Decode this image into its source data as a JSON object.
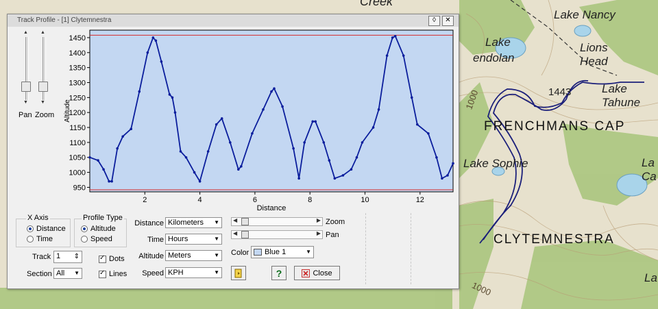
{
  "map": {
    "labels": [
      "Creek",
      "Lake Nancy",
      "Lake",
      "Lake",
      "endolan",
      "Lions",
      "Head",
      "1443",
      "Lake",
      "Tahune",
      "FRENCHMANS CAP",
      "Lake Sophie",
      "La",
      "Ca",
      "CLYTEMNESTRA",
      "1000",
      "1000",
      "La"
    ],
    "colors": {
      "water": "#a9d4ea",
      "forest": "#a7c47a",
      "track": "#1b1f7a"
    }
  },
  "window": {
    "title": "Track Profile - [1] Clytemnestra",
    "buttons": {
      "restore": "◊",
      "close": "✕"
    }
  },
  "sliders": {
    "pan_label": "Pan",
    "zoom_label": "Zoom",
    "pan_level": 0.83,
    "zoom_level": 0.83
  },
  "x_axis_group": {
    "title": "X Axis",
    "options": [
      "Distance",
      "Time"
    ],
    "selected": "Distance"
  },
  "profile_type_group": {
    "title": "Profile Type",
    "options": [
      "Altitude",
      "Speed"
    ],
    "selected": "Altitude"
  },
  "track": {
    "label": "Track",
    "value": "1"
  },
  "section": {
    "label": "Section",
    "value": "All"
  },
  "checks": {
    "dots_label": "Dots",
    "dots": true,
    "lines_label": "Lines",
    "lines": true
  },
  "units": {
    "distance_label": "Distance",
    "distance": "Kilometers",
    "time_label": "Time",
    "time": "Hours",
    "altitude_label": "Altitude",
    "altitude": "Meters",
    "speed_label": "Speed",
    "speed": "KPH"
  },
  "view": {
    "zoom_label": "Zoom",
    "pan_label": "Pan",
    "zoom_position": 0.0,
    "pan_position": 0.0
  },
  "color": {
    "label": "Color",
    "value": "Blue 1",
    "swatch": "#c3d7f2"
  },
  "buttons": {
    "help": "?",
    "close": "Close"
  },
  "chart_data": {
    "type": "line",
    "xlabel": "Distance",
    "ylabel": "Altitude",
    "xlim": [
      0,
      13.2
    ],
    "ylim": [
      935,
      1475
    ],
    "x_ticks": [
      2,
      4,
      6,
      8,
      10,
      12
    ],
    "y_ticks": [
      950,
      1000,
      1050,
      1100,
      1150,
      1200,
      1250,
      1300,
      1350,
      1400,
      1450
    ],
    "max_line": 1458,
    "min_line": 942,
    "plot_bg": "#c3d7f2",
    "line_color": "#0a1d9c",
    "ref_line_color": "#d42b2b",
    "series": [
      {
        "x": [
          0,
          0.3,
          0.5,
          0.7,
          0.8,
          1.0,
          1.2,
          1.5,
          1.8,
          2.1,
          2.3,
          2.4,
          2.6,
          2.9,
          3.0,
          3.1,
          3.3,
          3.5,
          3.8,
          4.0,
          4.3,
          4.6,
          4.8,
          5.1,
          5.4,
          5.5,
          5.9,
          6.3,
          6.6,
          6.7,
          7.0,
          7.4,
          7.6,
          7.8,
          8.1,
          8.2,
          8.5,
          8.7,
          8.9,
          9.2,
          9.5,
          9.7,
          9.9,
          10.3,
          10.5,
          10.8,
          11.0,
          11.1,
          11.4,
          11.7,
          11.9,
          12.3,
          12.6,
          12.8,
          13.0,
          13.2
        ],
        "y": [
          1050,
          1040,
          1010,
          970,
          970,
          1080,
          1120,
          1145,
          1270,
          1400,
          1450,
          1440,
          1370,
          1260,
          1250,
          1200,
          1070,
          1050,
          1000,
          970,
          1070,
          1160,
          1180,
          1100,
          1010,
          1020,
          1130,
          1210,
          1270,
          1280,
          1220,
          1080,
          980,
          1100,
          1170,
          1170,
          1100,
          1040,
          980,
          990,
          1010,
          1050,
          1100,
          1150,
          1210,
          1390,
          1450,
          1455,
          1390,
          1250,
          1160,
          1130,
          1050,
          980,
          990,
          1030
        ]
      }
    ]
  }
}
